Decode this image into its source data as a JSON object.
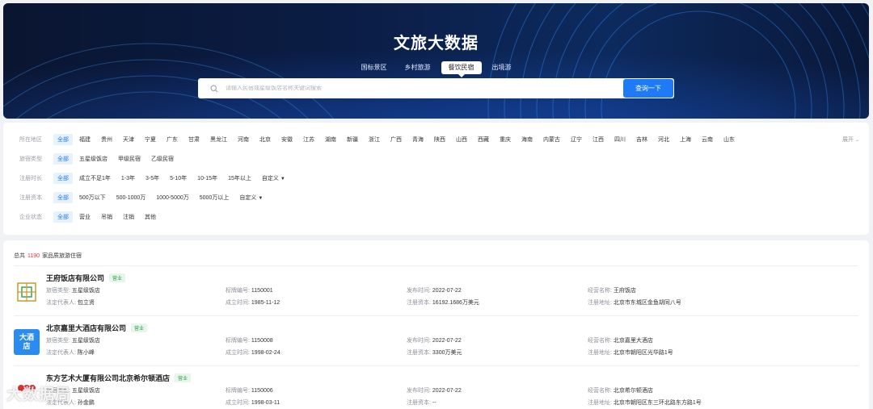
{
  "hero": {
    "title": "文旅大数据",
    "tabs": [
      {
        "label": "国标景区",
        "active": false
      },
      {
        "label": "乡村旅游",
        "active": false
      },
      {
        "label": "餐饮民宿",
        "active": true
      },
      {
        "label": "出境游",
        "active": false
      }
    ],
    "search": {
      "placeholder": "请输入民宿或星级饭店名称关键词搜索",
      "button_label": "查询一下"
    }
  },
  "filters": {
    "expand_label": "展开",
    "rows": [
      {
        "label": "所在地区",
        "options": [
          "全部",
          "福建",
          "贵州",
          "天津",
          "宁夏",
          "广东",
          "甘肃",
          "黑龙江",
          "河南",
          "北京",
          "安徽",
          "江苏",
          "湖南",
          "新疆",
          "浙江",
          "广西",
          "青海",
          "陕西",
          "山西",
          "西藏",
          "重庆",
          "海南",
          "内蒙古",
          "辽宁",
          "江西",
          "四川",
          "吉林",
          "河北",
          "上海",
          "云南",
          "山东"
        ]
      },
      {
        "label": "旅宿类型",
        "options": [
          "全部",
          "五星级饭店",
          "甲级民宿",
          "乙级民宿"
        ]
      },
      {
        "label": "注册时长",
        "options": [
          "全部",
          "成立不足1年",
          "1-3年",
          "3-5年",
          "5-10年",
          "10-15年",
          "15年以上",
          "自定义"
        ]
      },
      {
        "label": "注册资本",
        "options": [
          "全部",
          "500万以下",
          "500-1000万",
          "1000-5000万",
          "5000万以上",
          "自定义"
        ]
      },
      {
        "label": "企业状态",
        "options": [
          "全部",
          "营业",
          "吊销",
          "注销",
          "其他"
        ]
      }
    ]
  },
  "results": {
    "total_prefix": "总共",
    "total_count": "1190",
    "total_suffix": "家品质旅游住宿",
    "items": [
      {
        "name": "王府饭店有限公司",
        "status": "营业",
        "logo_icon": "wangfu-logo-icon",
        "type_label": "旅宿类型:",
        "type": "五星级饭店",
        "rep_label": "法定代表人:",
        "rep": "包立贤",
        "code_label": "标牌编号:",
        "code": "1150001",
        "founded_label": "成立时间:",
        "founded": "1985-11-12",
        "pub_label": "发布时间:",
        "pub": "2022-07-22",
        "capital_label": "注册资本:",
        "capital": "16192.1686万美元",
        "op_label": "经营名称:",
        "op": "王府饭店",
        "addr_label": "注册地址:",
        "addr": "北京市东城区金鱼胡同八号"
      },
      {
        "name": "北京嘉里大酒店有限公司",
        "status": "营业",
        "logo_text": "大酒店",
        "type_label": "旅宿类型:",
        "type": "五星级饭店",
        "rep_label": "法定代表人:",
        "rep": "陈小峰",
        "code_label": "标牌编号:",
        "code": "1150008",
        "founded_label": "成立时间:",
        "founded": "1998-02-24",
        "pub_label": "发布时间:",
        "pub": "2022-07-22",
        "capital_label": "注册资本:",
        "capital": "3300万美元",
        "op_label": "经营名称:",
        "op": "北京嘉里大酒店",
        "addr_label": "注册地址:",
        "addr": "北京市朝阳区光华路1号"
      },
      {
        "name": "东方艺术大厦有限公司北京希尔顿酒店",
        "status": "营业",
        "logo_icon": "hilton-logo-icon",
        "type_label": "旅宿类型:",
        "type": "五星级饭店",
        "rep_label": "法定代表人:",
        "rep": "孙金鹏",
        "code_label": "标牌编号:",
        "code": "1150006",
        "founded_label": "成立时间:",
        "founded": "1998-03-11",
        "pub_label": "发布时间:",
        "pub": "2022-07-22",
        "capital_label": "注册资本:",
        "capital": "--",
        "op_label": "经营名称:",
        "op": "北京希尔顿酒店",
        "addr_label": "注册地址:",
        "addr": "北京市朝阳区东三环北路东方路1号"
      }
    ]
  },
  "watermark": "大数据局",
  "colors": {
    "accent": "#1e7bf5",
    "hero_bg": "#0b1d45",
    "count_red": "#e03b3b",
    "badge_green": "#3aa14a"
  }
}
